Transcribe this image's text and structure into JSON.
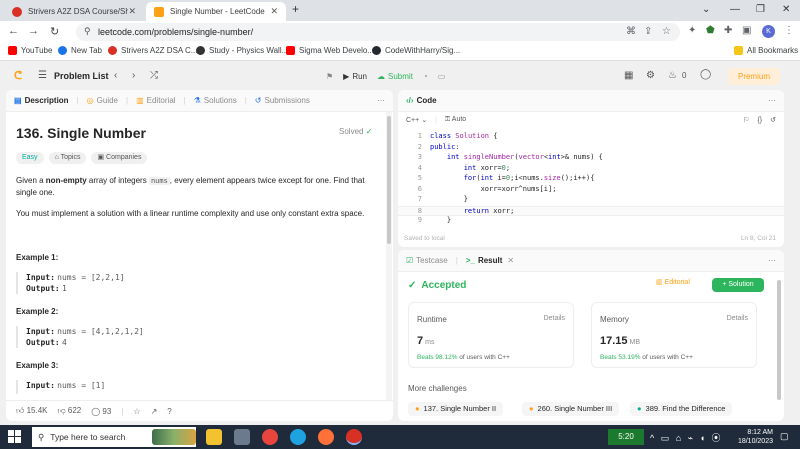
{
  "browser": {
    "tabs": [
      {
        "title": "Strivers A2Z DSA Course/Sheet",
        "active": false
      },
      {
        "title": "Single Number - LeetCode",
        "active": true
      }
    ],
    "url": "leetcode.com/problems/single-number/",
    "profile_initial": "K",
    "bookmarks": [
      "YouTube",
      "New Tab",
      "Strivers A2Z DSA C...",
      "Study - Physics Wall...",
      "Sigma Web Develo...",
      "CodeWithHarry/Sig..."
    ],
    "all_bookmarks": "All Bookmarks"
  },
  "nav": {
    "problem_list": "Problem List",
    "run": "Run",
    "submit": "Submit",
    "streak": "0",
    "premium": "Premium"
  },
  "left": {
    "tabs": [
      "Description",
      "Guide",
      "Editorial",
      "Solutions",
      "Submissions"
    ],
    "title": "136. Single Number",
    "solved": "Solved",
    "tags": [
      "Easy",
      "Topics",
      "Companies"
    ],
    "desc": {
      "p1a": "Given a ",
      "p1b": "non-empty",
      "p1c": " array of integers ",
      "p1code": "nums",
      "p1d": ", every element appears twice except for one. Find that single one.",
      "p2": "You must implement a solution with a linear runtime complexity and use only constant extra space."
    },
    "examples": [
      {
        "title": "Example 1:",
        "input_label": "Input:",
        "input": "nums = [2,2,1]",
        "output_label": "Output:",
        "output": "1"
      },
      {
        "title": "Example 2:",
        "input_label": "Input:",
        "input": "nums = [4,1,2,1,2]",
        "output_label": "Output:",
        "output": "4"
      },
      {
        "title": "Example 3:",
        "input_label": "Input:",
        "input": "nums = [1]"
      }
    ],
    "footer": {
      "likes": "15.4K",
      "dislikes": "622",
      "comments": "93"
    }
  },
  "code": {
    "tab": "Code",
    "language": "C++",
    "mode": "Auto",
    "lines": [
      "class Solution {",
      "public:",
      "    int singleNumber(vector<int>& nums) {",
      "        int xorr=0;",
      "        for(int i=0;i<nums.size();i++){",
      "            xorr=xorr^nums[i];",
      "        }",
      "        return xorr;",
      "    }"
    ],
    "status": "Saved to local",
    "cursor": "Ln 8, Col 21"
  },
  "result": {
    "tabs": [
      "Testcase",
      "Result"
    ],
    "status": "Accepted",
    "editorial": "Editorial",
    "solution": "Solution",
    "runtime": {
      "label": "Runtime",
      "details": "Details",
      "value": "7",
      "unit": "ms",
      "beats": "Beats 98.12%",
      "suffix": "of users with C++"
    },
    "memory": {
      "label": "Memory",
      "details": "Details",
      "value": "17.15",
      "unit": "MB",
      "beats": "Beats 53.19%",
      "suffix": "of users with C++"
    },
    "more": "More challenges",
    "challenges": [
      "137. Single Number II",
      "260. Single Number III",
      "389. Find the Difference"
    ]
  },
  "taskbar": {
    "search": "Type here to search",
    "battery": "5:20",
    "time": "8:12 AM",
    "date": "18/10/2023"
  },
  "colors": {
    "accent": "#ffa116",
    "success": "#2db55d",
    "easy": "#00af9b"
  }
}
